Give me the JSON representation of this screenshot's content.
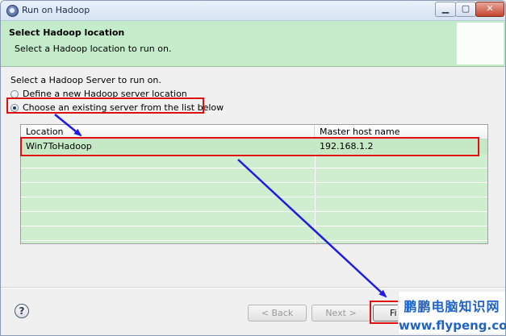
{
  "window": {
    "title": "Run on Hadoop",
    "controls": {
      "minimize": "▁",
      "maximize": "▢",
      "close": "✕"
    }
  },
  "banner": {
    "title": "Select Hadoop location",
    "subtitle": "Select a Hadoop location to run on."
  },
  "form": {
    "section_label": "Select a Hadoop Server to run on.",
    "option_define": "Define a new Hadoop server location",
    "option_choose": "Choose an existing server from the list below",
    "selected_option": "choose"
  },
  "table": {
    "columns": [
      "Location",
      "Master host name"
    ],
    "rows": [
      {
        "location": "Win7ToHadoop",
        "host": "192.168.1.2"
      }
    ]
  },
  "footer": {
    "help": "?",
    "back": "< Back",
    "next": "Next >",
    "finish": "Fi"
  },
  "watermark": {
    "text_cn": "鹏鹏电脑知识网",
    "url": "www.flypeng.com"
  },
  "colors": {
    "banner_bg": "#c4ecca",
    "highlight_red": "#e01010",
    "arrow_blue": "#1c1ce6",
    "watermark_blue": "#1f63c6"
  }
}
